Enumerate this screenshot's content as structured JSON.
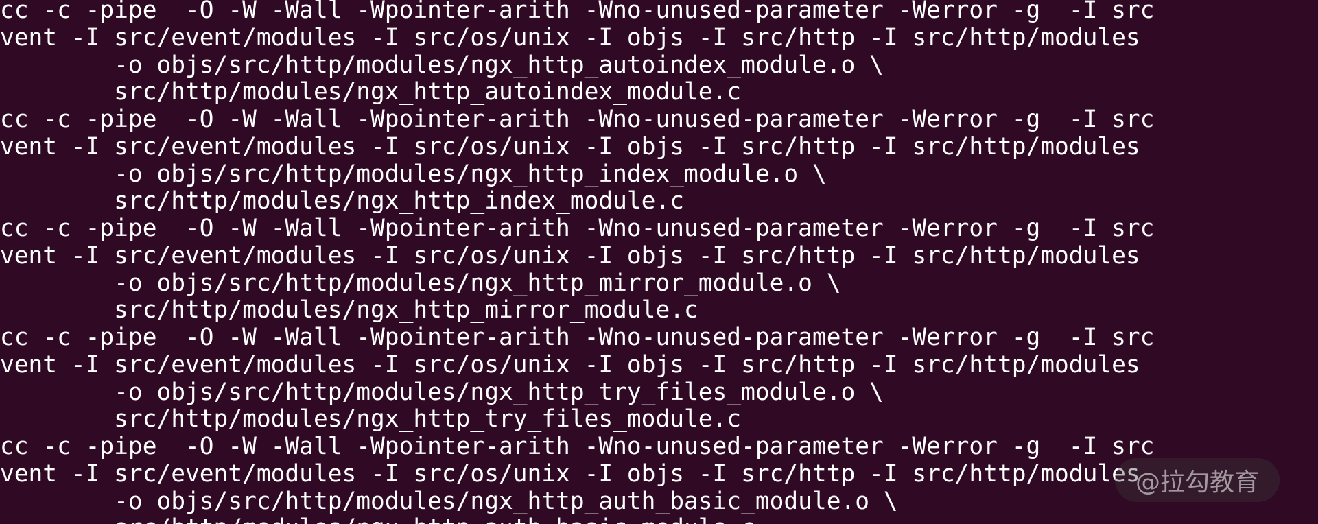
{
  "terminal": {
    "lines": [
      "cc -c -pipe  -O -W -Wall -Wpointer-arith -Wno-unused-parameter -Werror -g  -I src",
      "vent -I src/event/modules -I src/os/unix -I objs -I src/http -I src/http/modules",
      "        -o objs/src/http/modules/ngx_http_autoindex_module.o \\",
      "        src/http/modules/ngx_http_autoindex_module.c",
      "cc -c -pipe  -O -W -Wall -Wpointer-arith -Wno-unused-parameter -Werror -g  -I src",
      "vent -I src/event/modules -I src/os/unix -I objs -I src/http -I src/http/modules",
      "        -o objs/src/http/modules/ngx_http_index_module.o \\",
      "        src/http/modules/ngx_http_index_module.c",
      "cc -c -pipe  -O -W -Wall -Wpointer-arith -Wno-unused-parameter -Werror -g  -I src",
      "vent -I src/event/modules -I src/os/unix -I objs -I src/http -I src/http/modules",
      "        -o objs/src/http/modules/ngx_http_mirror_module.o \\",
      "        src/http/modules/ngx_http_mirror_module.c",
      "cc -c -pipe  -O -W -Wall -Wpointer-arith -Wno-unused-parameter -Werror -g  -I src",
      "vent -I src/event/modules -I src/os/unix -I objs -I src/http -I src/http/modules",
      "        -o objs/src/http/modules/ngx_http_try_files_module.o \\",
      "        src/http/modules/ngx_http_try_files_module.c",
      "cc -c -pipe  -O -W -Wall -Wpointer-arith -Wno-unused-parameter -Werror -g  -I src",
      "vent -I src/event/modules -I src/os/unix -I objs -I src/http -I src/http/modules",
      "        -o objs/src/http/modules/ngx_http_auth_basic_module.o \\",
      "        src/http/modules/ngx_http_auth_basic_module.c"
    ],
    "background_color": "#300a24",
    "text_color": "#ffffff"
  },
  "watermark": {
    "text": "@拉勾教育"
  }
}
